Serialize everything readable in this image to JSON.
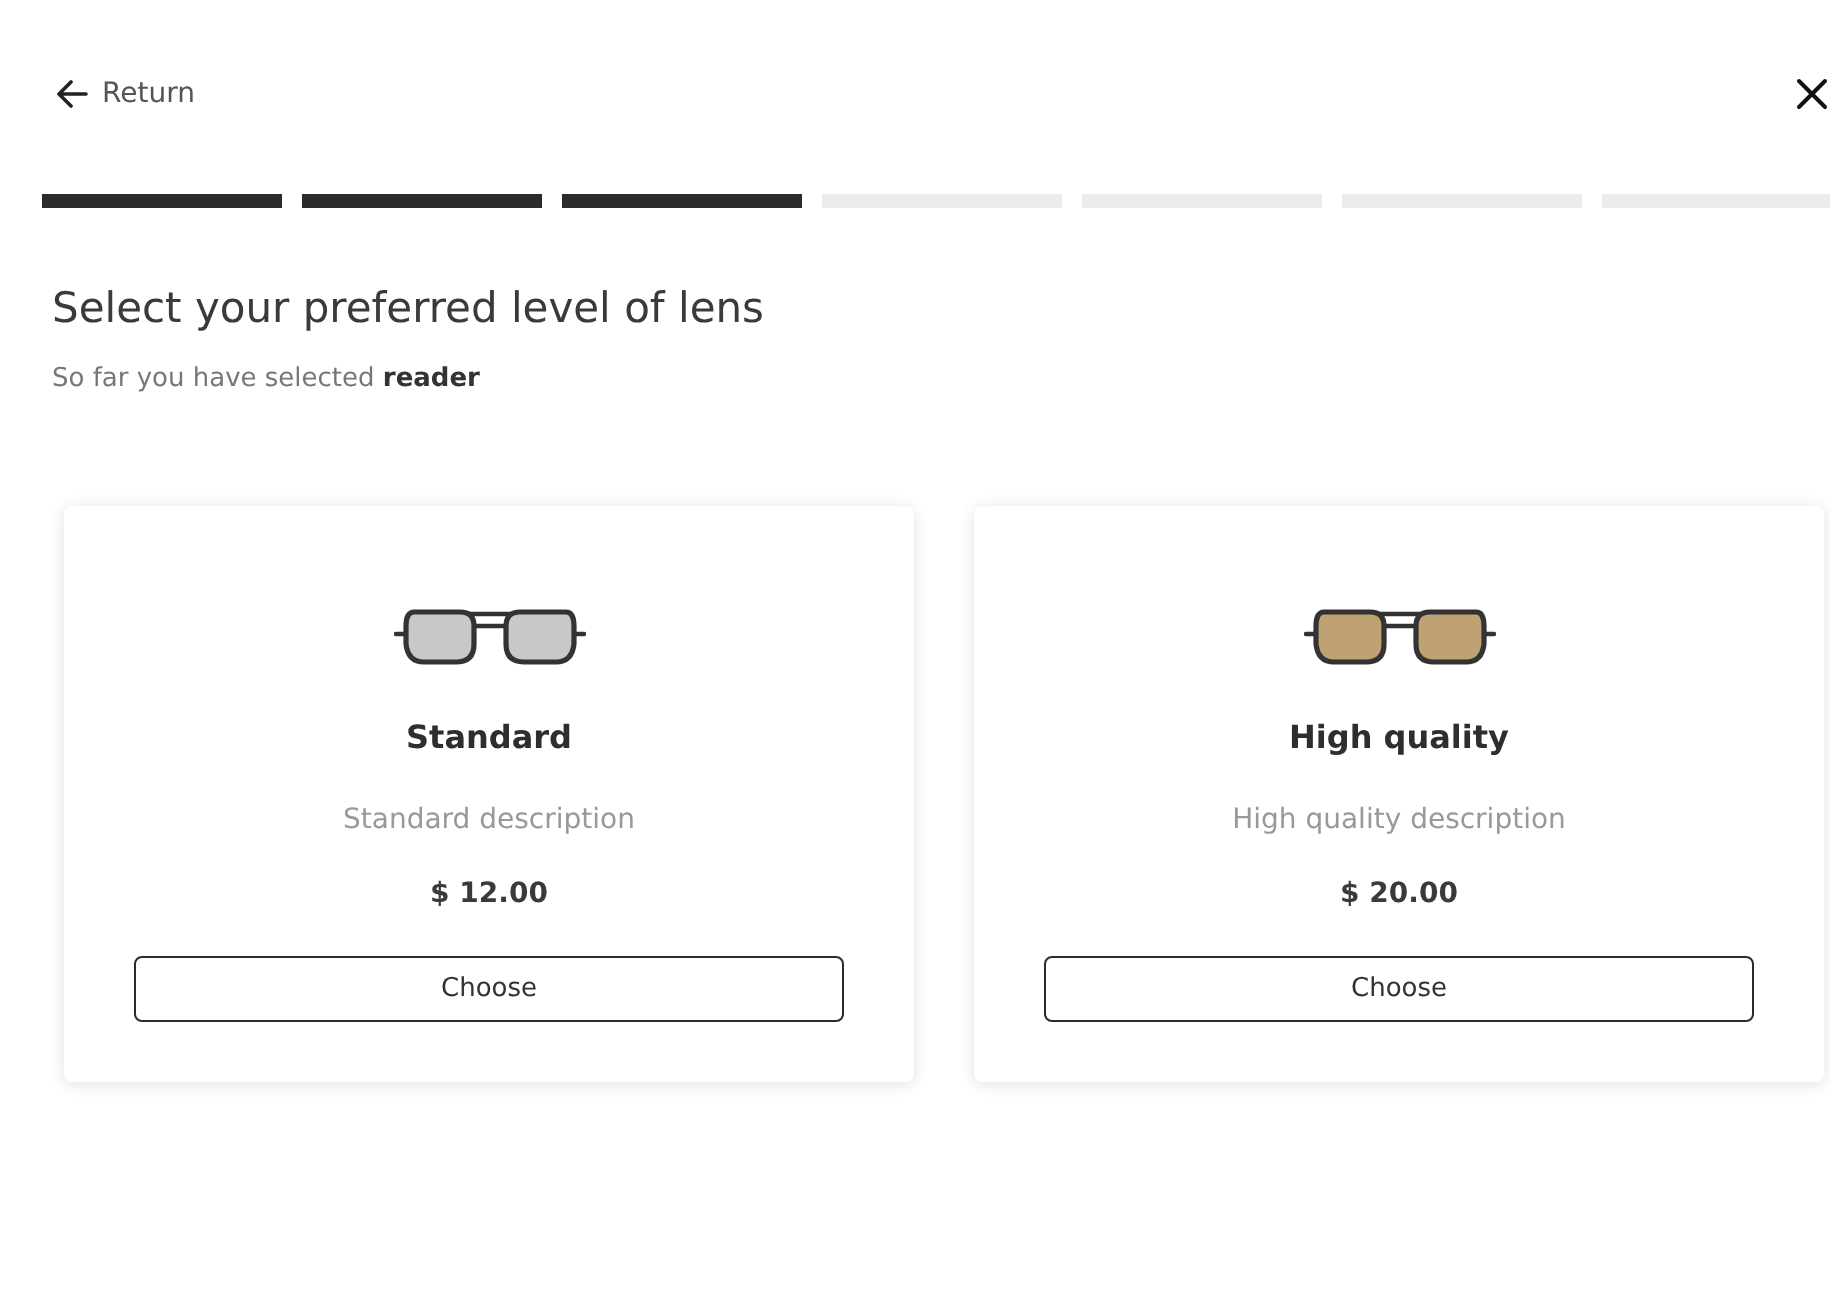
{
  "header": {
    "back_label": "Return"
  },
  "progress": {
    "steps": [
      {
        "done": true
      },
      {
        "done": true
      },
      {
        "done": true
      },
      {
        "done": false
      },
      {
        "done": false
      },
      {
        "done": false
      },
      {
        "done": false
      }
    ]
  },
  "heading": "Select your preferred level of lens",
  "subtitle": "So far you have selected **reader**",
  "cards": [
    {
      "title": "Standard",
      "description": "Standard description",
      "price": "$ 12.00",
      "color": "#c8c8c8",
      "button": "Choose"
    },
    {
      "title": "High quality",
      "description": "High quality description",
      "price": "$ 20.00",
      "color": "#c0a174",
      "button": "Choose"
    }
  ]
}
